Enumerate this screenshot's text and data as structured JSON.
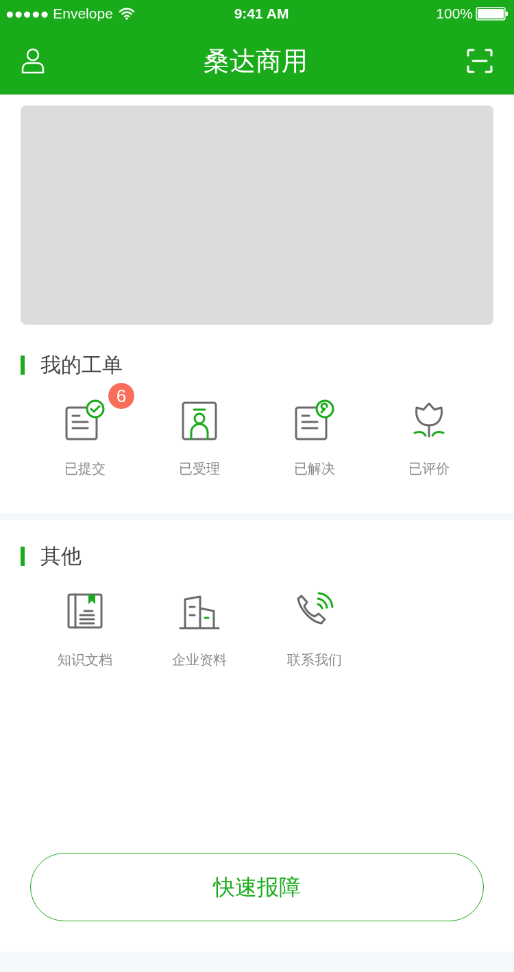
{
  "status_bar": {
    "carrier": "●●●●● Envelope",
    "time": "9:41 AM",
    "battery": "100%"
  },
  "nav": {
    "title": "桑达商用"
  },
  "banner": {
    "kind": "placeholder"
  },
  "sections": [
    {
      "title": "我的工单",
      "items": [
        {
          "kind": "submitted",
          "label": "已提交",
          "badge": "6"
        },
        {
          "kind": "accepted",
          "label": "已受理"
        },
        {
          "kind": "resolved",
          "label": "已解决"
        },
        {
          "kind": "rated",
          "label": "已评价"
        }
      ]
    },
    {
      "title": "其他",
      "items": [
        {
          "kind": "docs",
          "label": "知识文档"
        },
        {
          "kind": "company",
          "label": "企业资料"
        },
        {
          "kind": "contact",
          "label": "联系我们"
        }
      ]
    }
  ],
  "action_button": "快速报障"
}
